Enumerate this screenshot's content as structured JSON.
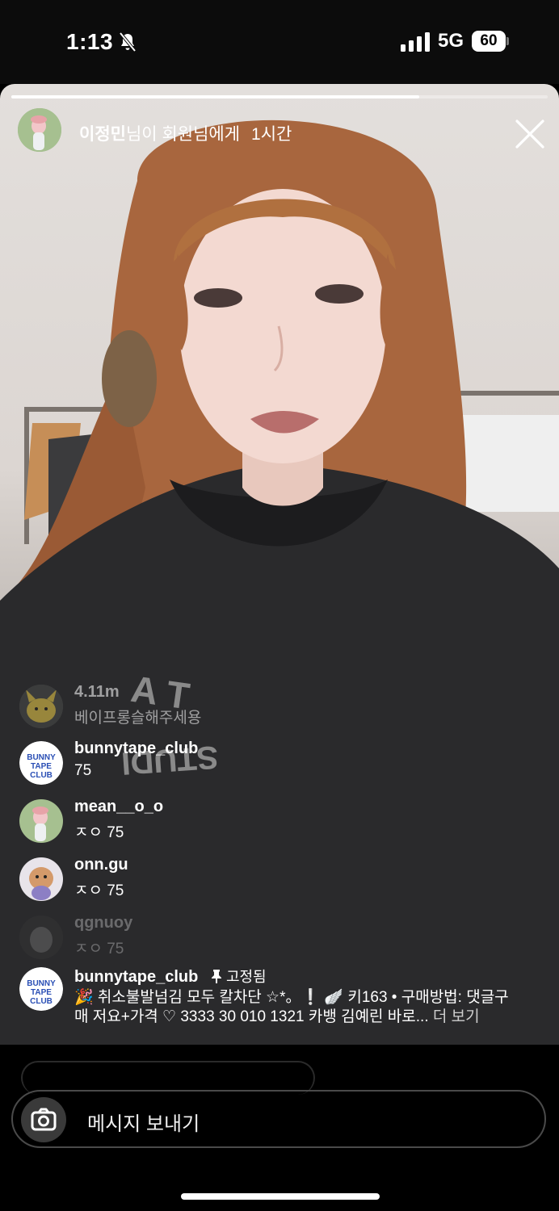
{
  "status_bar": {
    "time": "1:13",
    "network": "5G",
    "battery": "60"
  },
  "live": {
    "progress": 0.76,
    "header": {
      "username": "이정민",
      "message": "님이 회원님에게",
      "time_ago": "1시간"
    }
  },
  "comments": [
    {
      "user": "4.11m",
      "text": "베이프롱슬해주세용",
      "style": "faded"
    },
    {
      "user": "bunnytape_club",
      "text": "75",
      "style": "normal"
    },
    {
      "user": "mean__o_o",
      "text": "ㅈㅇ 75",
      "style": "normal"
    },
    {
      "user": "onn.gu",
      "text": "ㅈㅇ 75",
      "style": "normal"
    },
    {
      "user": "qgnuoy",
      "text": "ㅈㅇ 75",
      "style": "faded2"
    }
  ],
  "pinned": {
    "user": "bunnytape_club",
    "tag": "고정됨",
    "line1": "🎉 취소불발넘김 모두 칼차단 ☆*。❕ 🪽 키163 • 구매방법: 댓글구",
    "line2": "매 저요+가격 ♡ 3333 30 010 1321 카뱅 김예린 바로...",
    "more": "더 보기"
  },
  "message_bar": {
    "placeholder": "메시지 보내기"
  }
}
